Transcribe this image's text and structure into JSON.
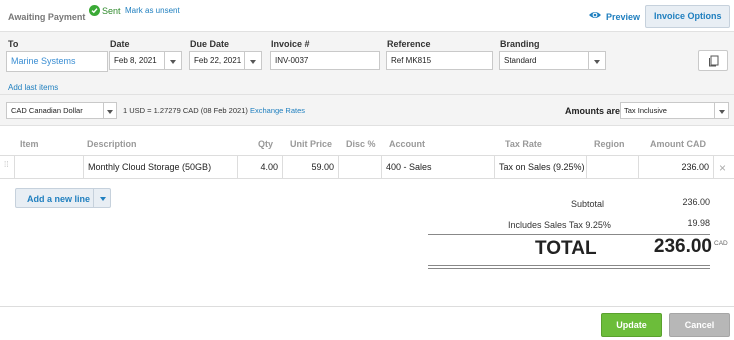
{
  "status": {
    "label": "Awaiting Payment",
    "sent_label": "Sent",
    "mark_unsent": "Mark as unsent"
  },
  "actions": {
    "preview": "Preview",
    "invoice_options": "Invoice Options"
  },
  "fields": {
    "to_label": "To",
    "to_value": "Marine Systems",
    "date_label": "Date",
    "date_value": "Feb 8, 2021",
    "due_label": "Due Date",
    "due_value": "Feb 22, 2021",
    "invoice_label": "Invoice #",
    "invoice_value": "INV-0037",
    "reference_label": "Reference",
    "reference_value": "Ref MK815",
    "branding_label": "Branding",
    "branding_value": "Standard",
    "add_last_items": "Add last items"
  },
  "currency": {
    "selected": "CAD Canadian Dollar",
    "rate": "1 USD = 1.27279 CAD (08 Feb 2021)",
    "rate_link": "Exchange Rates",
    "amounts_are_label": "Amounts are",
    "amounts_are_value": "Tax Inclusive"
  },
  "table": {
    "headers": {
      "item": "Item",
      "description": "Description",
      "qty": "Qty",
      "unit_price": "Unit Price",
      "disc": "Disc %",
      "account": "Account",
      "tax_rate": "Tax Rate",
      "region": "Region",
      "amount": "Amount CAD"
    },
    "rows": [
      {
        "item": "",
        "description": "Monthly Cloud Storage (50GB)",
        "qty": "4.00",
        "unit_price": "59.00",
        "disc": "",
        "account": "400 - Sales",
        "tax_rate": "Tax on Sales (9.25%)",
        "region": "",
        "amount": "236.00"
      }
    ],
    "add_line": "Add a new line"
  },
  "totals": {
    "subtotal_label": "Subtotal",
    "subtotal_value": "236.00",
    "tax_label": "Includes Sales Tax 9.25%",
    "tax_value": "19.98",
    "total_label": "TOTAL",
    "total_value": "236.00",
    "currency": "CAD"
  },
  "footer": {
    "update": "Update",
    "cancel": "Cancel"
  },
  "colors": {
    "accent": "#1f7fbf",
    "sent_green": "#3aa935",
    "update_green": "#6cbd3a",
    "cancel_grey": "#b7b7b7"
  },
  "icons": [
    "check-circle-icon",
    "eye-icon",
    "chevron-down-icon",
    "copy-icon",
    "drag-handle-icon",
    "close-icon"
  ]
}
